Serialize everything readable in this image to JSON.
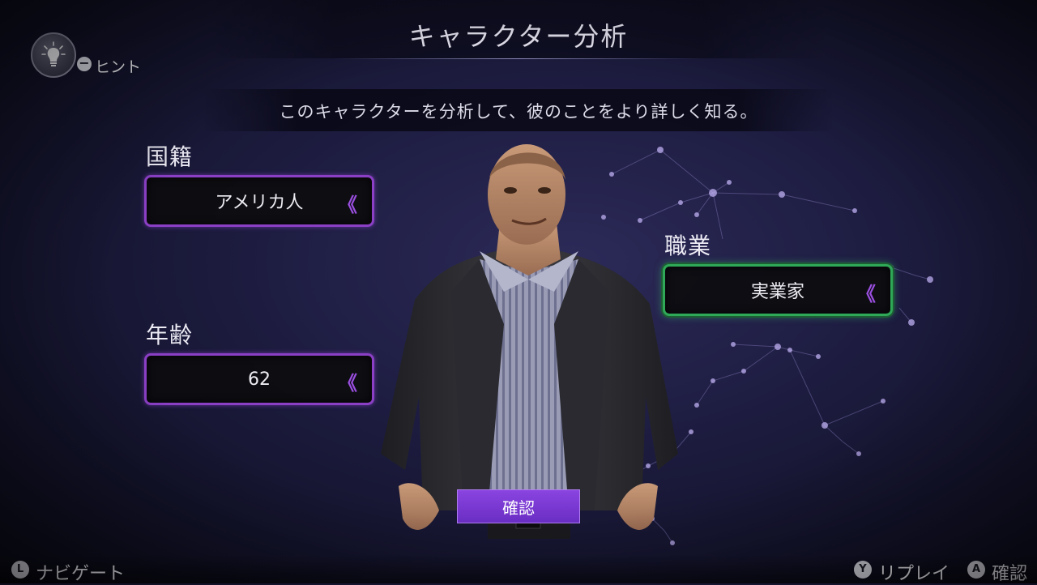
{
  "header": {
    "title": "キャラクター分析"
  },
  "subtitle": "このキャラクターを分析して、彼のことをより詳しく知る。",
  "hint": {
    "button_glyph": "−",
    "label": "ヒント"
  },
  "fields": {
    "nationality": {
      "label": "国籍",
      "value": "アメリカ人"
    },
    "age": {
      "label": "年齢",
      "value": "62"
    },
    "occupation": {
      "label": "職業",
      "value": "実業家"
    }
  },
  "selector_glyph": "《",
  "confirm_button": "確認",
  "footer": {
    "navigate": {
      "button": "L",
      "label": "ナビゲート"
    },
    "replay": {
      "button": "Y",
      "label": "リプレイ"
    },
    "confirm": {
      "button": "A",
      "label": "確認"
    }
  },
  "colors": {
    "selector_border": "#8a3fc4",
    "selector_active_border": "#2fa857",
    "confirm_button": "#7a38d4"
  }
}
